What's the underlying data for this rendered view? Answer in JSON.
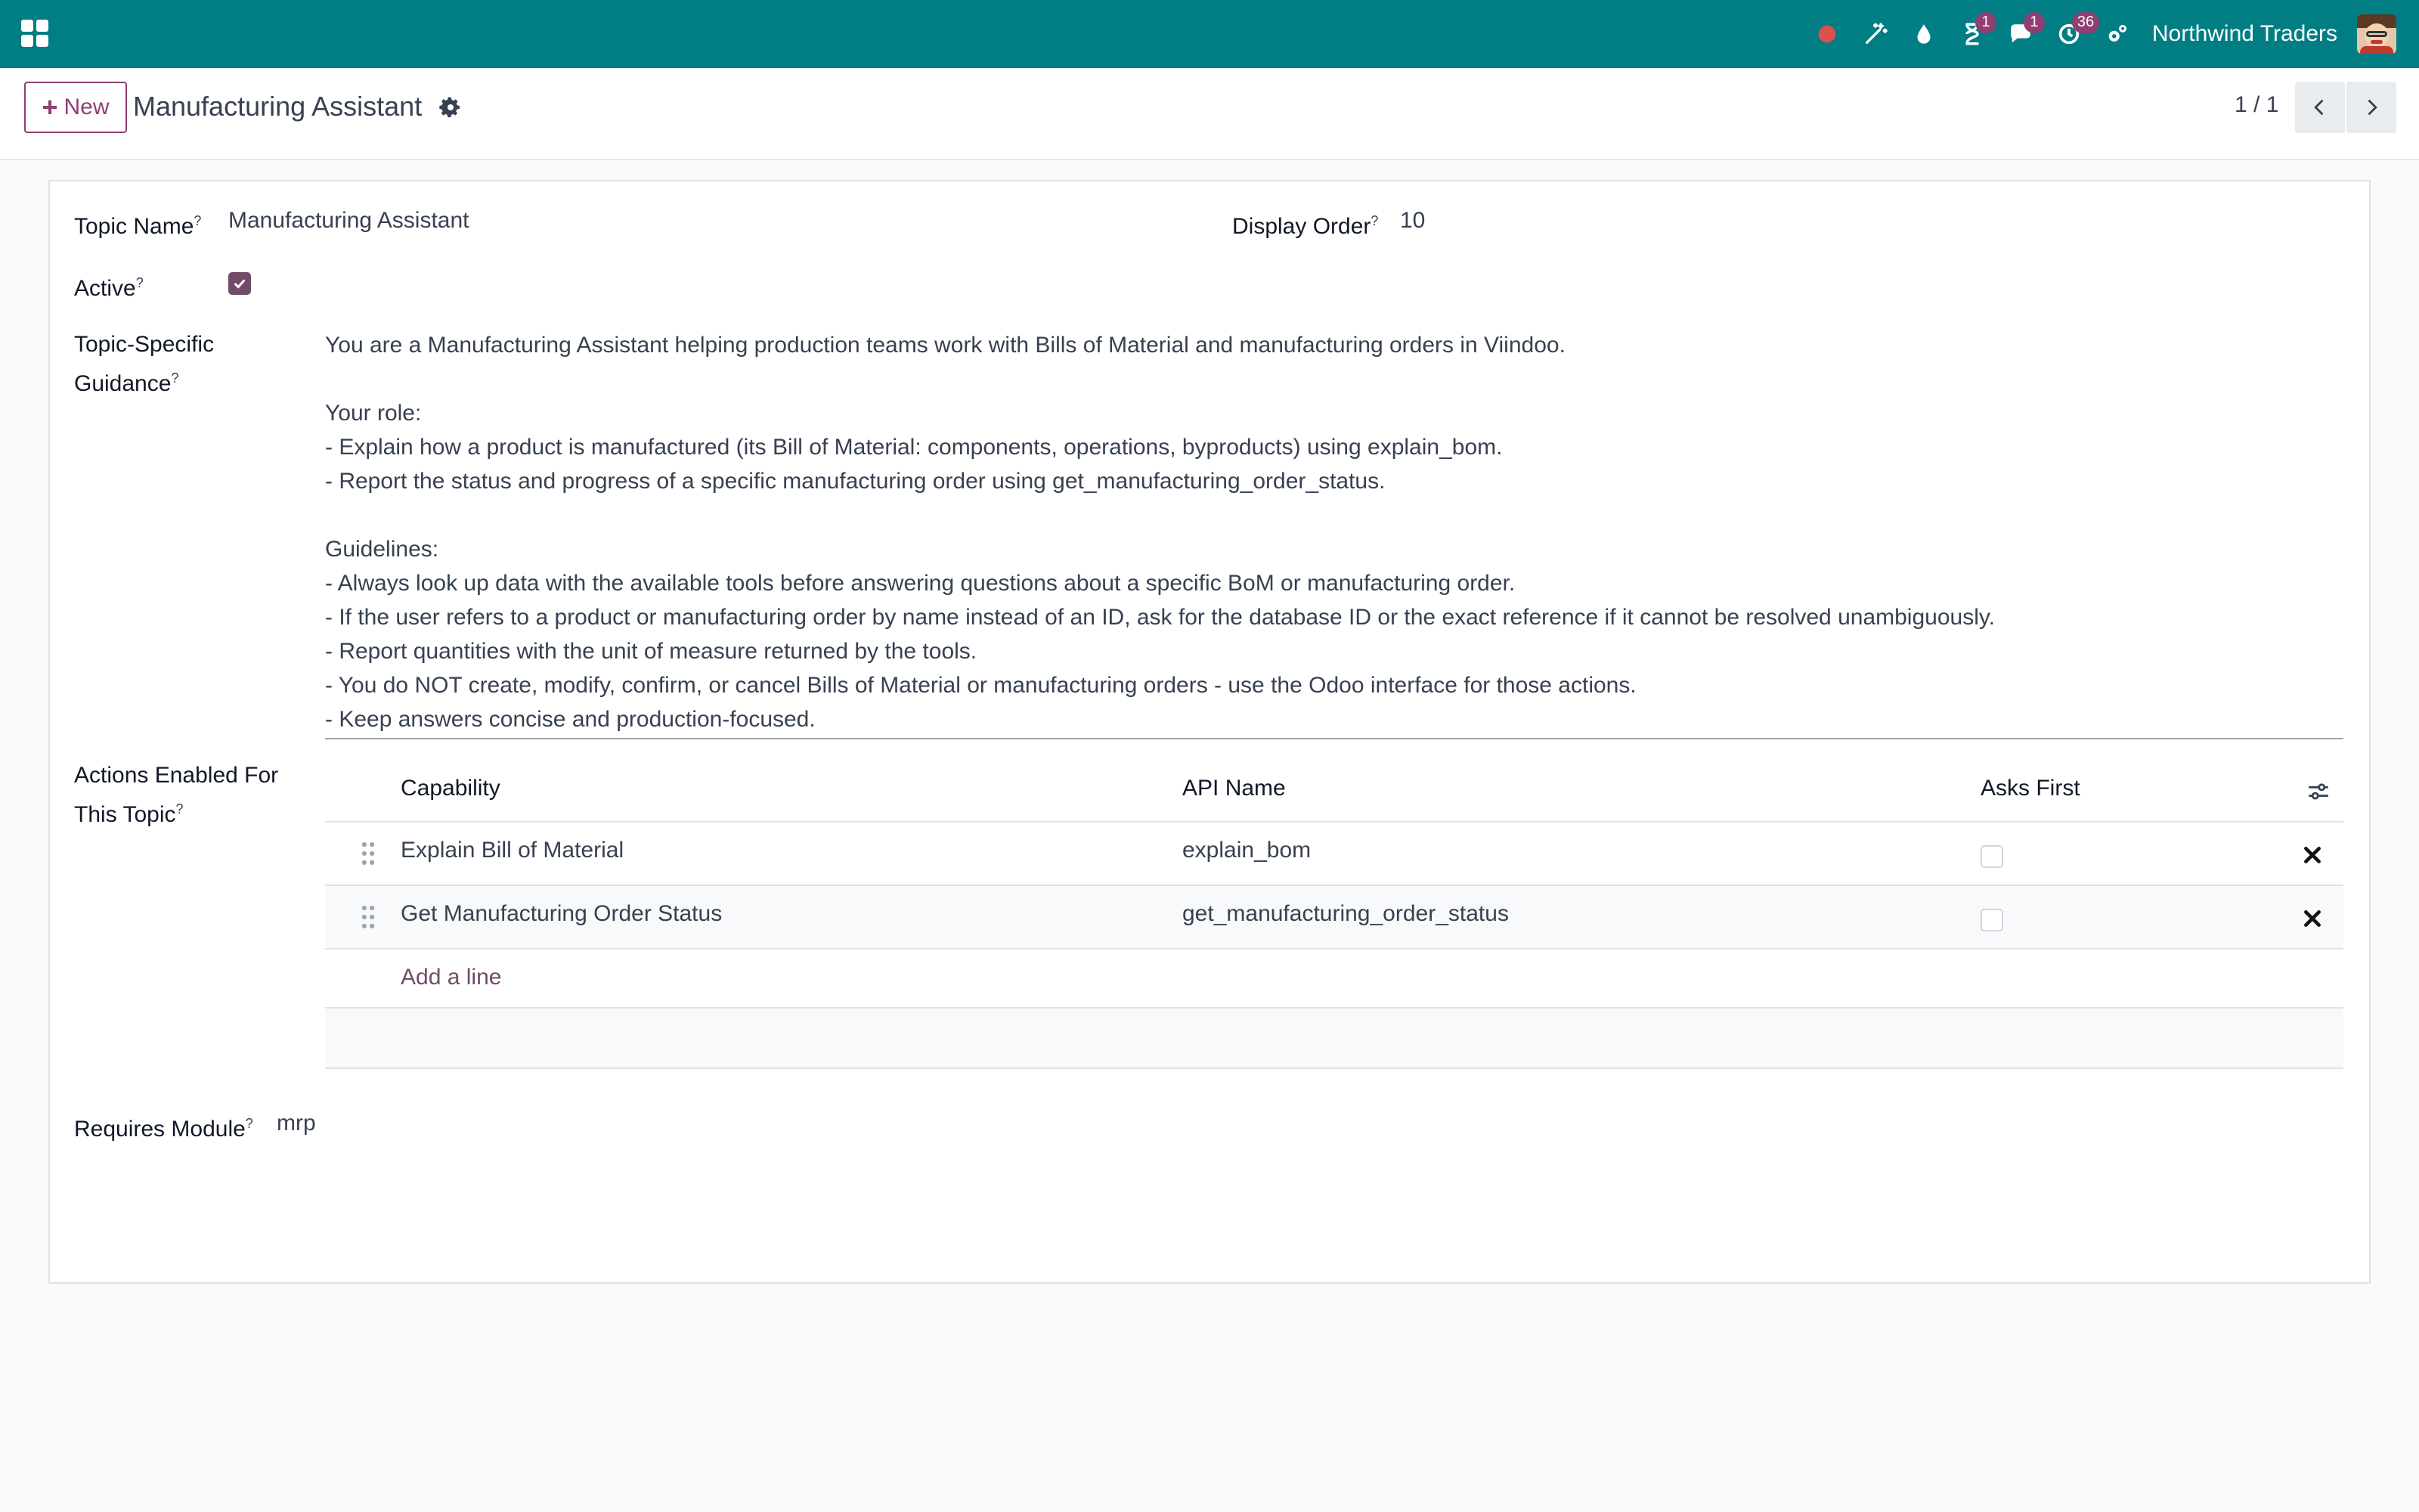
{
  "navbar": {
    "company": "Northwind Traders",
    "badges": {
      "activity": "1",
      "messages": "1",
      "clock": "36"
    }
  },
  "control_panel": {
    "new_label": "New",
    "title": "Manufacturing Assistant",
    "pager": "1 / 1"
  },
  "form": {
    "topic_name_label": "Topic Name",
    "topic_name_value": "Manufacturing Assistant",
    "display_order_label": "Display Order",
    "display_order_value": "10",
    "active_label": "Active",
    "active_checked": true,
    "guidance_label_line1": "Topic-Specific",
    "guidance_label_line2": "Guidance",
    "guidance_text": "You are a Manufacturing Assistant helping production teams work with Bills of Material and manufacturing orders in Viindoo.\n\nYour role:\n- Explain how a product is manufactured (its Bill of Material: components, operations, byproducts) using explain_bom.\n- Report the status and progress of a specific manufacturing order using get_manufacturing_order_status.\n\nGuidelines:\n- Always look up data with the available tools before answering questions about a specific BoM or manufacturing order.\n- If the user refers to a product or manufacturing order by name instead of an ID, ask for the database ID or the exact reference if it cannot be resolved unambiguously.\n- Report quantities with the unit of measure returned by the tools.\n- You do NOT create, modify, confirm, or cancel Bills of Material or manufacturing orders - use the Odoo interface for those actions.\n- Keep answers concise and production-focused.",
    "actions_label_line1": "Actions Enabled For",
    "actions_label_line2": "This Topic",
    "requires_module_label": "Requires Module",
    "requires_module_value": "mrp",
    "help_mark": "?"
  },
  "actions_table": {
    "columns": {
      "capability": "Capability",
      "api_name": "API Name",
      "asks_first": "Asks First"
    },
    "rows": [
      {
        "capability": "Explain Bill of Material",
        "api_name": "explain_bom",
        "asks_first": false
      },
      {
        "capability": "Get Manufacturing Order Status",
        "api_name": "get_manufacturing_order_status",
        "asks_first": false
      }
    ],
    "add_line": "Add a line"
  },
  "colors": {
    "navbar": "#017e84",
    "primary": "#714b67",
    "badge": "#8f3f71"
  }
}
